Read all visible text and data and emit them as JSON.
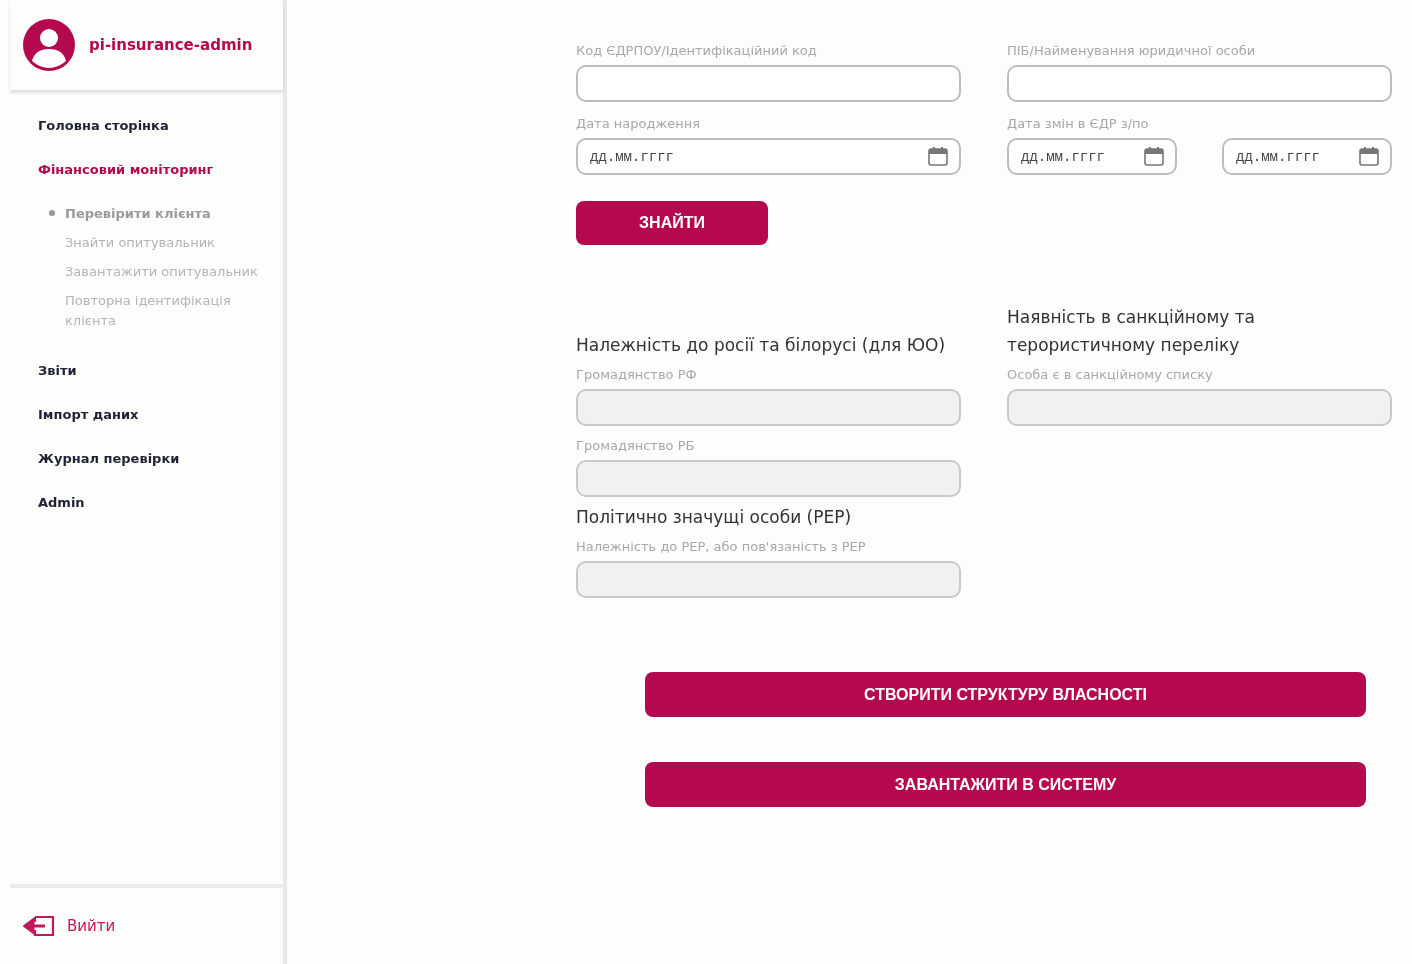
{
  "sidebar": {
    "user": "pi-insurance-admin",
    "items": [
      {
        "label": "Головна сторінка",
        "selected": false
      },
      {
        "label": "Фінансовий моніторинг",
        "selected": true,
        "children": [
          {
            "label": "Перевірити клієнта",
            "selected": true
          },
          {
            "label": "Знайти опитувальник",
            "selected": false
          },
          {
            "label": "Завантажити опитувальник",
            "selected": false
          },
          {
            "label": "Повторна ідентифікація клієнта",
            "selected": false
          }
        ]
      },
      {
        "label": "Звіти",
        "selected": false
      },
      {
        "label": "Імпорт даних",
        "selected": false
      },
      {
        "label": "Журнал перевірки",
        "selected": false
      },
      {
        "label": "Admin",
        "selected": false
      }
    ],
    "logout": "Вийти"
  },
  "search": {
    "code": {
      "label": "Код ЄДРПОУ/Ідентифікаційний код",
      "disabled": false
    },
    "name": {
      "label": "ПІБ/Найменування юридичної особи",
      "disabled": false
    },
    "birth_date": {
      "label": "Дата народження",
      "placeholder": "дд.мм.гггг"
    },
    "edr_change": {
      "label": "Дата змін в ЄДР з/по",
      "from_placeholder": "дд.мм.гггг",
      "to_placeholder": "дд.мм.гггг"
    },
    "button": "ЗНАЙТИ"
  },
  "russia_belarus": {
    "title": "Належність до росії та білорусі (для ЮО)",
    "fields": [
      {
        "label": "Громадянство РФ",
        "disabled": true
      },
      {
        "label": "Громадянство РБ",
        "disabled": true
      }
    ]
  },
  "pep": {
    "title": "Політично значущі особи (PEP)",
    "fields": [
      {
        "label": "Належність до PEP, або пов'язаність з PEP",
        "disabled": true
      }
    ]
  },
  "sanctions": {
    "title": "Наявність в санкційному та терористичному переліку",
    "fields": [
      {
        "label": "Особа є в санкційному списку",
        "disabled": true
      }
    ]
  },
  "actions": [
    "СТВОРИТИ СТРУКТУРУ ВЛАСНОСТІ",
    "ЗАВАНТАЖИТИ В СИСТЕМУ"
  ]
}
